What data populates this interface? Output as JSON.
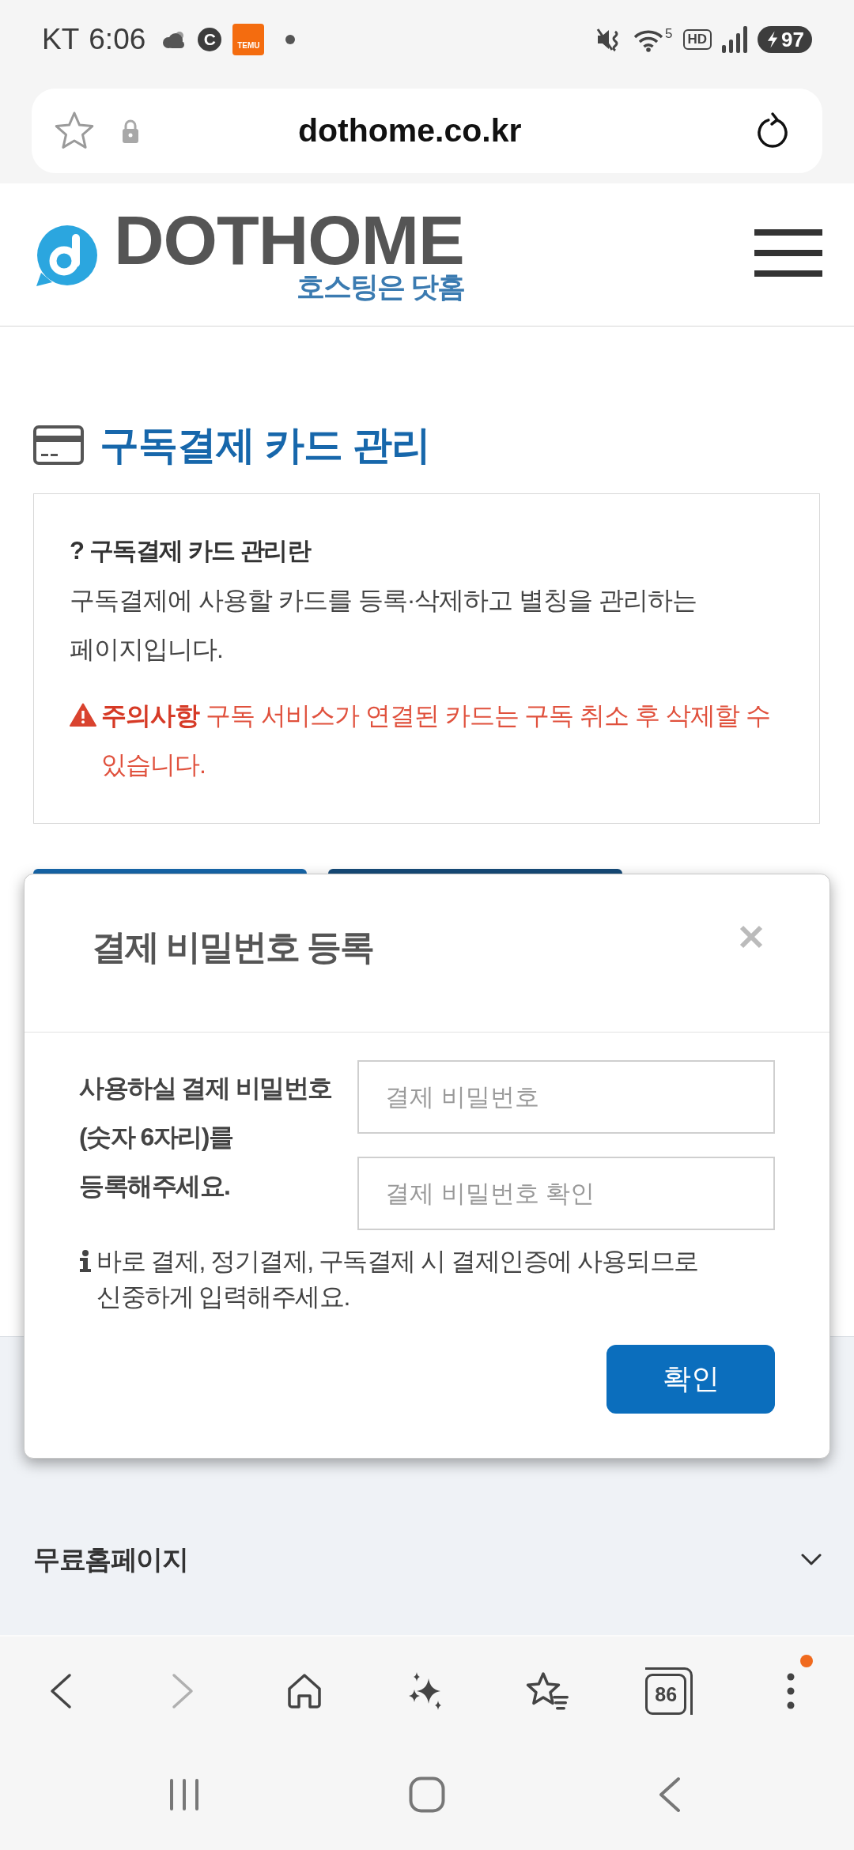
{
  "status_bar": {
    "carrier": "KT",
    "time": "6:06",
    "badge_letter": "C",
    "app_tile_text": "TEMU",
    "wifi_band": "5",
    "hd_label": "HD",
    "battery": "97"
  },
  "address_bar": {
    "url": "dothome.co.kr"
  },
  "header": {
    "logo_text": "DOTHOME",
    "tagline": "호스팅은 닷홈"
  },
  "page": {
    "title": "구독결제 카드 관리",
    "info": {
      "heading": "? 구독결제 카드 관리란",
      "description": "구독결제에 사용할 카드를 등록·삭제하고 별칭을 관리하는 페이지입니다.",
      "warning": "**주의사항** 구독 서비스가 연결된 카드는 구독 취소 후 삭제할 수 있습니다."
    }
  },
  "modal": {
    "title": "결제 비밀번호 등록",
    "prompt": "사용하실 결제 비밀번호 (숫자 6자리)를 등록해주세요.",
    "fields": [
      {
        "placeholder": "결제 비밀번호"
      },
      {
        "placeholder": "결제 비밀번호 확인"
      }
    ],
    "note": "바로 결제, 정기결제, 구독결제 시 결제인증에 사용되므로 신중하게 입력해주세요.",
    "confirm": "확인"
  },
  "footer": {
    "menu": [
      {
        "label": "무료홈페이지",
        "expanded": false
      }
    ]
  },
  "toolbar": {
    "forward_disabled": true,
    "tab_count": "86",
    "menu_notification": true
  }
}
